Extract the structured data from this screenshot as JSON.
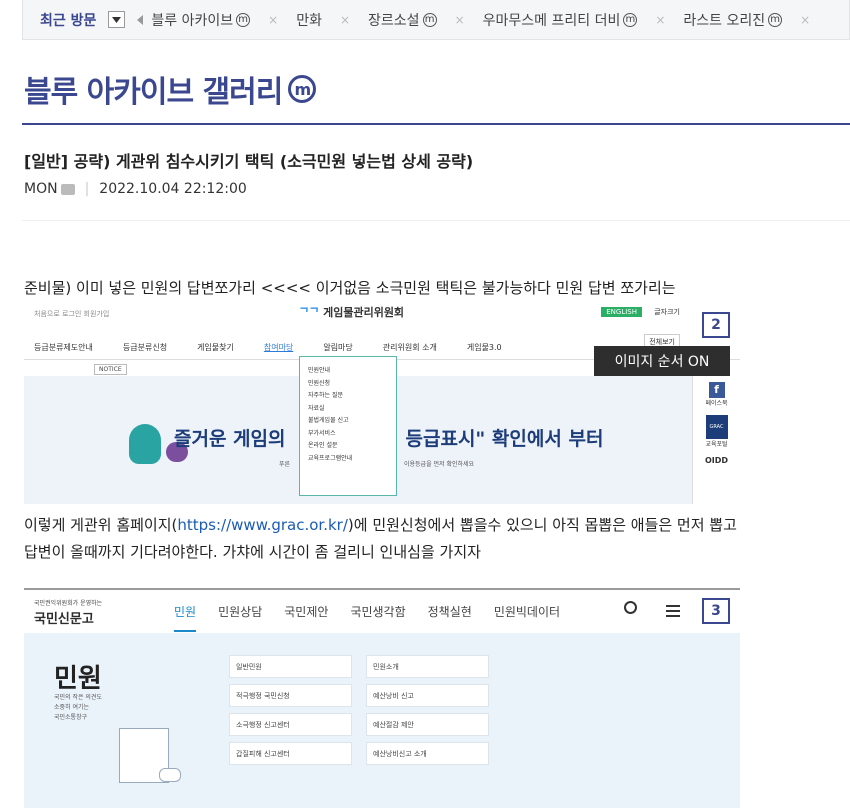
{
  "recent": {
    "title": "최근 방문",
    "items": [
      {
        "label": "블루 아카이브",
        "mark": "ⓜ"
      },
      {
        "label": "만화",
        "mark": ""
      },
      {
        "label": "장르소설",
        "mark": "ⓜ"
      },
      {
        "label": "우마무스메 프리티 더비",
        "mark": "ⓜ"
      },
      {
        "label": "라스트 오리진",
        "mark": "ⓜ"
      }
    ],
    "close": "×"
  },
  "gallery": {
    "title": "블루 아카이브 갤러리",
    "mark": "m"
  },
  "post": {
    "title": "[일반] 공략) 게관위 침수시키기 택틱 (소극민원 넣는법 상세 공략)",
    "author": "MON",
    "separator": "|",
    "datetime": "2022.10.04 22:12:00"
  },
  "content": {
    "para1": "준비물) 이미 넣은 민원의 답변쪼가리 <<<< 이거없음 소극민원 택틱은 불가능하다 민원 답변 쪼가리는",
    "para2_pre": "이렇게 게관위 홈페이지(",
    "para2_link": "https://www.grac.or.kr/",
    "para2_post": ")에 민원신청에서 뽑을수 있으니 아직 몹뽑은 애들은 먼저 뽑고",
    "para3": "답변이 올때까지 기다려야한다. 가챠에 시간이 좀 걸리니 인내심을 가지자",
    "badge2": "2",
    "badge3": "3",
    "tooltip": "이미지 순서 ON"
  },
  "shot1": {
    "top_links": "처음으로  로그인  회원가입",
    "logo": "게임물관리위원회",
    "eng": "ENGLISH",
    "font_size": "글자크기",
    "all_view": "전체보기",
    "nav": [
      "등급분류제도안내",
      "등급분류신청",
      "게임물찾기",
      "참여마당",
      "알림마당",
      "관리위원회 소개",
      "게임물3.0"
    ],
    "notice": "NOTICE",
    "dropdown": [
      "민원안내",
      "민원신청",
      "자주하는 질문",
      "자료실",
      "불법게임물 신고",
      "부가서비스",
      "온라인 설문",
      "교육프로그램안내"
    ],
    "banner_left": "즐거운 게임의",
    "banner_right": "등급표시\" 확인에서 부터",
    "sub_left": "푸른",
    "sub_right": "이용등급을 먼저 확인하세요",
    "side_fb": "f",
    "side_fb_label": "페이스북",
    "side_grac": "GRAC",
    "side_grac_label": "교육포털",
    "side_oidd": "OIDD"
  },
  "shot2": {
    "logo_small": "국민권익위원회가 운영하는",
    "logo_big": "국민신문고",
    "nav": [
      "민원",
      "민원상담",
      "국민제안",
      "국민생각함",
      "정책실현",
      "민원빅데이터"
    ],
    "heading": "민원",
    "desc": [
      "국민의 작은 의견도",
      "소중히 여기는",
      "국민소통창구"
    ],
    "col1": [
      "일반민원",
      "적극행정 국민신청",
      "소극행정 신고센터",
      "갑질피해 신고센터"
    ],
    "col2": [
      "민원소개",
      "예산낭비 신고",
      "예산절감 제안",
      "예산낭비신고 소개"
    ]
  }
}
